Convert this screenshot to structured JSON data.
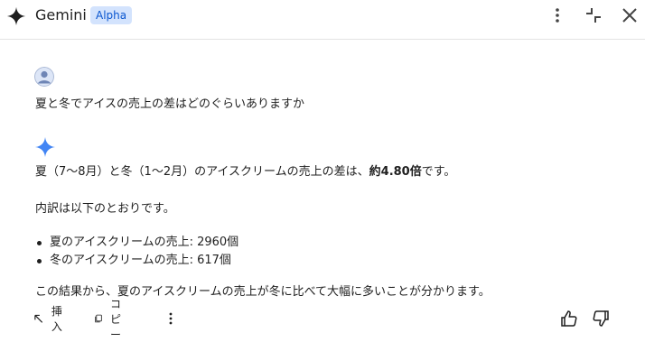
{
  "header": {
    "app_title": "Gemini",
    "badge": "Alpha",
    "icons": [
      "more-vert-icon",
      "collapse-icon",
      "close-icon"
    ]
  },
  "prompt": {
    "text": "夏と冬でアイスの売上の差はどのぐらいありますか"
  },
  "response": {
    "line1_pre": "夏（7〜8月）と冬（1〜2月）のアイスクリームの売上の差は、",
    "line1_bold": "約4.80倍",
    "line1_post": "です。",
    "line2": "内訳は以下のとおりです。",
    "bullets": [
      "夏のアイスクリームの売上: 2960個",
      "冬のアイスクリームの売上: 617個"
    ],
    "conclusion": "この結果から、夏のアイスクリームの売上が冬に比べて大幅に多いことが分かります。"
  },
  "actions": {
    "insert_label": "挿入",
    "copy_label": "コピー"
  },
  "colors": {
    "accent": "#0b57d0",
    "badge_bg": "#d3e3fd",
    "spark_blue": "#4285f4"
  }
}
